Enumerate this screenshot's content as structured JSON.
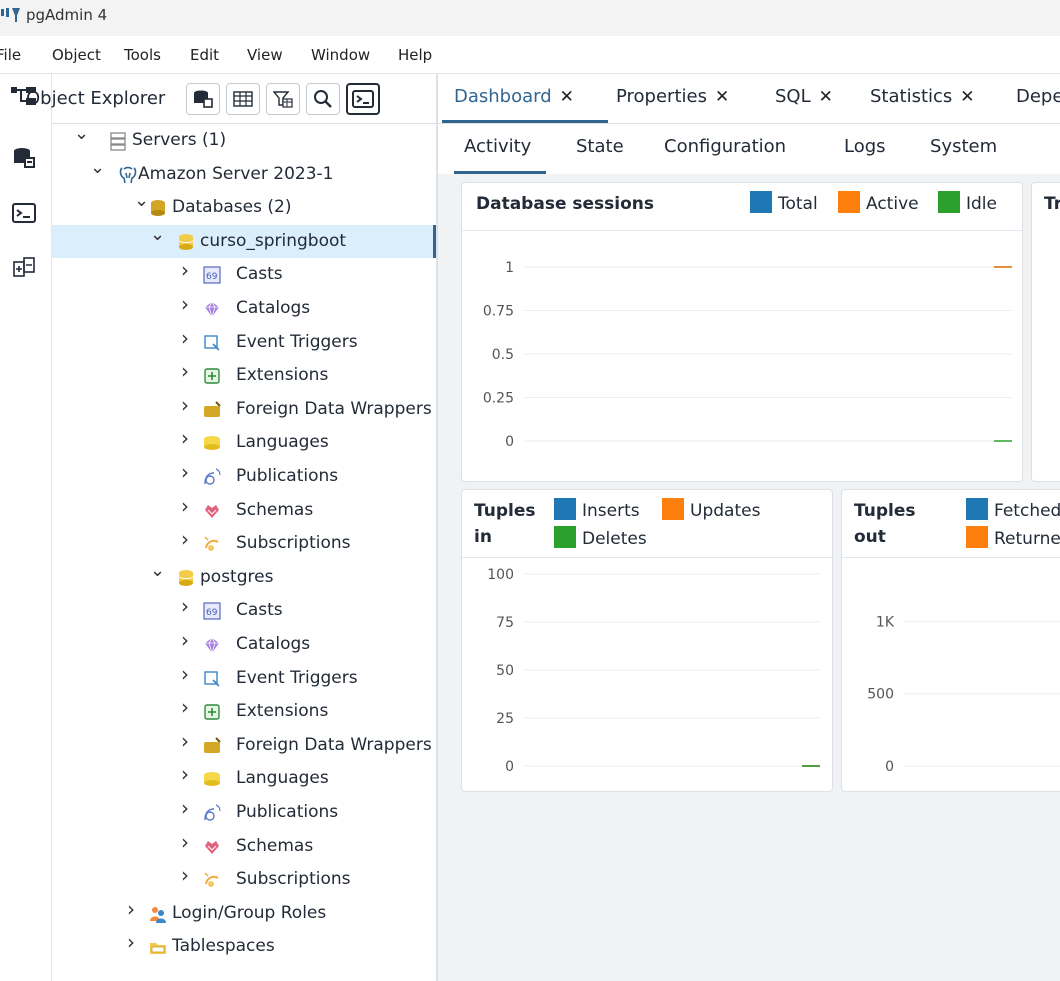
{
  "app": {
    "title": "pgAdmin 4"
  },
  "menu": [
    "File",
    "Object",
    "Tools",
    "Edit",
    "View",
    "Window",
    "Help"
  ],
  "explorer": {
    "title": "Object Explorer",
    "tools": [
      "query-tool-icon",
      "view-data-icon",
      "filtered-rows-icon",
      "search-objects-icon",
      "psql-tool-icon"
    ]
  },
  "tree": [
    {
      "label": "Servers (1)",
      "level": 0,
      "expanded": true,
      "icon": "servers-icon"
    },
    {
      "label": "Amazon Server 2023-1",
      "level": 1,
      "expanded": true,
      "icon": "elephant-icon"
    },
    {
      "label": "Databases (2)",
      "level": 2,
      "expanded": true,
      "icon": "databases-icon"
    },
    {
      "label": "curso_springboot",
      "level": 3,
      "expanded": true,
      "icon": "database-icon",
      "selected": true
    },
    {
      "label": "Casts",
      "level": 4,
      "expanded": false,
      "icon": "casts-icon"
    },
    {
      "label": "Catalogs",
      "level": 4,
      "expanded": false,
      "icon": "catalogs-icon"
    },
    {
      "label": "Event Triggers",
      "level": 4,
      "expanded": false,
      "icon": "event-triggers-icon"
    },
    {
      "label": "Extensions",
      "level": 4,
      "expanded": false,
      "icon": "extensions-icon"
    },
    {
      "label": "Foreign Data Wrappers",
      "level": 4,
      "expanded": false,
      "icon": "foreign-data-wrappers-icon"
    },
    {
      "label": "Languages",
      "level": 4,
      "expanded": false,
      "icon": "languages-icon"
    },
    {
      "label": "Publications",
      "level": 4,
      "expanded": false,
      "icon": "publications-icon"
    },
    {
      "label": "Schemas",
      "level": 4,
      "expanded": false,
      "icon": "schemas-icon"
    },
    {
      "label": "Subscriptions",
      "level": 4,
      "expanded": false,
      "icon": "subscriptions-icon"
    },
    {
      "label": "postgres",
      "level": 3,
      "expanded": true,
      "icon": "database-icon"
    },
    {
      "label": "Casts",
      "level": 4,
      "expanded": false,
      "icon": "casts-icon"
    },
    {
      "label": "Catalogs",
      "level": 4,
      "expanded": false,
      "icon": "catalogs-icon"
    },
    {
      "label": "Event Triggers",
      "level": 4,
      "expanded": false,
      "icon": "event-triggers-icon"
    },
    {
      "label": "Extensions",
      "level": 4,
      "expanded": false,
      "icon": "extensions-icon"
    },
    {
      "label": "Foreign Data Wrappers",
      "level": 4,
      "expanded": false,
      "icon": "foreign-data-wrappers-icon"
    },
    {
      "label": "Languages",
      "level": 4,
      "expanded": false,
      "icon": "languages-icon"
    },
    {
      "label": "Publications",
      "level": 4,
      "expanded": false,
      "icon": "publications-icon"
    },
    {
      "label": "Schemas",
      "level": 4,
      "expanded": false,
      "icon": "schemas-icon"
    },
    {
      "label": "Subscriptions",
      "level": 4,
      "expanded": false,
      "icon": "subscriptions-icon"
    },
    {
      "label": "Login/Group Roles",
      "level": 2,
      "expanded": false,
      "icon": "login-roles-icon"
    },
    {
      "label": "Tablespaces",
      "level": 2,
      "expanded": false,
      "icon": "tablespaces-icon"
    }
  ],
  "tabs": [
    {
      "label": "Dashboard",
      "active": true
    },
    {
      "label": "Properties",
      "active": false
    },
    {
      "label": "SQL",
      "active": false
    },
    {
      "label": "Statistics",
      "active": false
    },
    {
      "label": "Dependencies",
      "active": false
    }
  ],
  "subtabs": [
    {
      "label": "Activity",
      "active": true
    },
    {
      "label": "State",
      "active": false
    },
    {
      "label": "Configuration",
      "active": false
    },
    {
      "label": "Logs",
      "active": false
    },
    {
      "label": "System",
      "active": false
    }
  ],
  "colors": {
    "accent": "#326690",
    "series_blue": "#1f77b4",
    "series_orange": "#ff7f0e",
    "series_green": "#2ca02c"
  },
  "chart_data": [
    {
      "type": "line",
      "title": "Database sessions",
      "series": [
        {
          "name": "Total",
          "color": "#1f77b4",
          "last": 1
        },
        {
          "name": "Active",
          "color": "#ff7f0e",
          "last": 1
        },
        {
          "name": "Idle",
          "color": "#2ca02c",
          "last": 0
        }
      ],
      "yticks": [
        "1",
        "0.75",
        "0.5",
        "0.25",
        "0"
      ],
      "ylim": [
        0,
        1
      ],
      "grid": true
    },
    {
      "type": "line",
      "title": "Transactions per second",
      "title_visible": "T s",
      "series": []
    },
    {
      "type": "line",
      "title": "Tuples in",
      "series": [
        {
          "name": "Inserts",
          "color": "#1f77b4",
          "last": 0
        },
        {
          "name": "Updates",
          "color": "#ff7f0e",
          "last": 0
        },
        {
          "name": "Deletes",
          "color": "#2ca02c",
          "last": 0
        }
      ],
      "yticks": [
        "100",
        "75",
        "50",
        "25",
        "0"
      ],
      "ylim": [
        0,
        100
      ],
      "grid": true
    },
    {
      "type": "line",
      "title": "Tuples out",
      "series": [
        {
          "name": "Fetched",
          "color": "#1f77b4"
        },
        {
          "name": "Returned",
          "color": "#ff7f0e"
        }
      ],
      "yticks": [
        "1K",
        "500",
        "0"
      ],
      "ylim": [
        0,
        1300
      ],
      "grid": true
    }
  ]
}
